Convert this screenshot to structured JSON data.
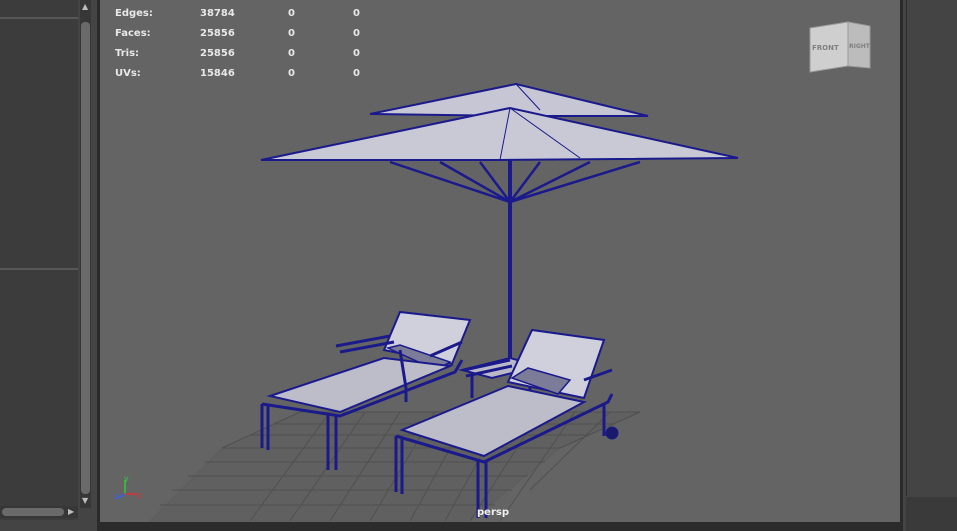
{
  "hud": {
    "rows": [
      {
        "label": "Edges:",
        "total": "38784",
        "selected": "0",
        "comp": "0"
      },
      {
        "label": "Faces:",
        "total": "25856",
        "selected": "0",
        "comp": "0"
      },
      {
        "label": "Tris:",
        "total": "25856",
        "selected": "0",
        "comp": "0"
      },
      {
        "label": "UVs:",
        "total": "15846",
        "selected": "0",
        "comp": "0"
      }
    ]
  },
  "viewcube": {
    "front_label": "FRONT",
    "right_label": "RIGHT"
  },
  "camera": {
    "label": "persp"
  },
  "axis": {
    "x": "x",
    "y": "y",
    "z": "z"
  },
  "colors": {
    "wire": "#1a1a8c",
    "surface": "#c7c7d3",
    "viewport_bg": "#646464"
  },
  "scene": {
    "objects": [
      "patio-umbrella",
      "sun-lounger-left",
      "sun-lounger-right",
      "grid-floor"
    ]
  }
}
